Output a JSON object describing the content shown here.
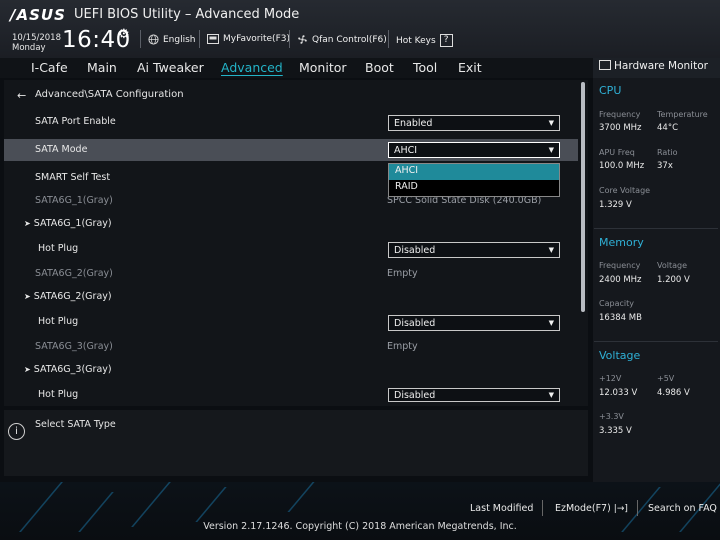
{
  "header": {
    "logo": "/ASUS",
    "title": "UEFI BIOS Utility – Advanced Mode",
    "date": "10/15/2018",
    "day": "Monday",
    "time": "16:40",
    "toolbar": [
      {
        "label": "English",
        "icon": "globe-icon"
      },
      {
        "label": "MyFavorite(F3)",
        "icon": "favorite-icon"
      },
      {
        "label": "Qfan Control(F6)",
        "icon": "fan-icon"
      },
      {
        "label": "Hot Keys",
        "icon": "help-icon",
        "help_glyph": "?"
      }
    ]
  },
  "tabs": [
    "I-Cafe",
    "Main",
    "Ai Tweaker",
    "Advanced",
    "Monitor",
    "Boot",
    "Tool",
    "Exit"
  ],
  "active_tab": "Advanced",
  "breadcrumb": "Advanced\\SATA Configuration",
  "settings": {
    "sata_port_enable": {
      "label": "SATA Port Enable",
      "value": "Enabled"
    },
    "sata_mode": {
      "label": "SATA Mode",
      "value": "AHCI",
      "options": [
        "AHCI",
        "RAID"
      ]
    },
    "smart_self_test": {
      "label": "SMART Self Test"
    },
    "port1": {
      "label": "SATA6G_1(Gray)",
      "device": "SPCC Solid State Disk (240.0GB)",
      "group": "SATA6G_1(Gray)",
      "hotplug_label": "Hot Plug",
      "hotplug_value": "Disabled"
    },
    "port2": {
      "label": "SATA6G_2(Gray)",
      "device": "Empty",
      "group": "SATA6G_2(Gray)",
      "hotplug_label": "Hot Plug",
      "hotplug_value": "Disabled"
    },
    "port3": {
      "label": "SATA6G_3(Gray)",
      "device": "Empty",
      "group": "SATA6G_3(Gray)",
      "hotplug_label": "Hot Plug",
      "hotplug_value": "Disabled"
    }
  },
  "help_text": "Select SATA Type",
  "hardware_monitor": {
    "title": "Hardware Monitor",
    "cpu": {
      "heading": "CPU",
      "frequency_label": "Frequency",
      "frequency_value": "3700 MHz",
      "temperature_label": "Temperature",
      "temperature_value": "44°C",
      "apu_label": "APU Freq",
      "apu_value": "100.0 MHz",
      "ratio_label": "Ratio",
      "ratio_value": "37x",
      "core_voltage_label": "Core Voltage",
      "core_voltage_value": "1.329 V"
    },
    "memory": {
      "heading": "Memory",
      "frequency_label": "Frequency",
      "frequency_value": "2400 MHz",
      "voltage_label": "Voltage",
      "voltage_value": "1.200 V",
      "capacity_label": "Capacity",
      "capacity_value": "16384 MB"
    },
    "voltage": {
      "heading": "Voltage",
      "v12_label": "+12V",
      "v12_value": "12.033 V",
      "v5_label": "+5V",
      "v5_value": "4.986 V",
      "v33_label": "+3.3V",
      "v33_value": "3.335 V"
    }
  },
  "footer": {
    "last_modified": "Last Modified",
    "ezmode": "EzMode(F7)",
    "search": "Search on FAQ",
    "copyright": "Version 2.17.1246. Copyright (C) 2018 American Megatrends, Inc."
  },
  "colors": {
    "accent": "#23b3c7",
    "section": "#2fb0d6",
    "highlight": "#1f8a9a",
    "selected_row": "#4a4e56"
  }
}
